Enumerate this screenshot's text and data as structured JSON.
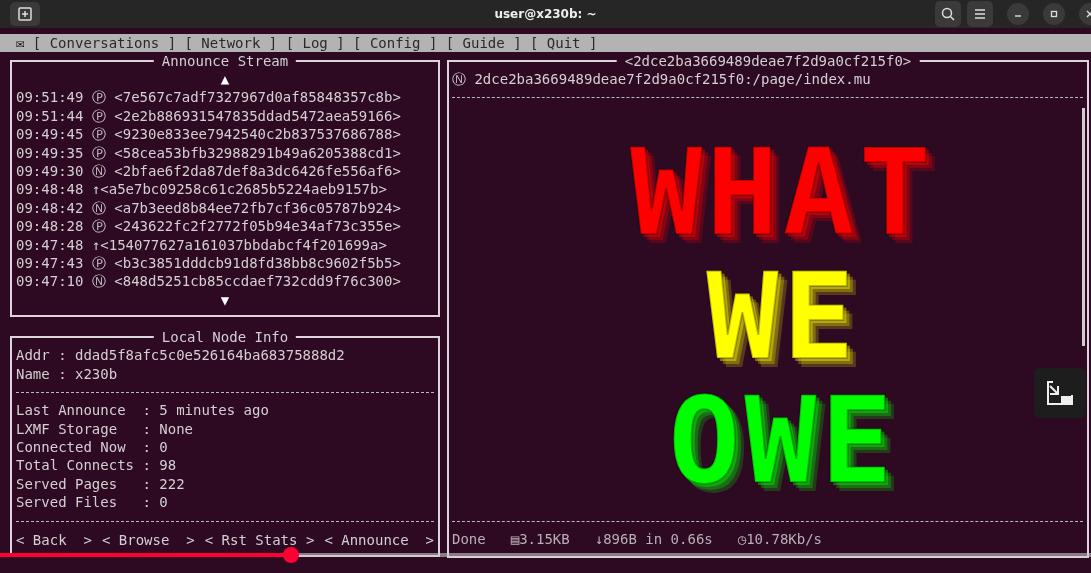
{
  "window": {
    "title": "user@x230b: ~"
  },
  "menu": {
    "icon": "✉",
    "items": [
      {
        "label": "[ Conversations ]"
      },
      {
        "label": "[ Network ]"
      },
      {
        "label": "[ Log ]"
      },
      {
        "label": "[ Config ]"
      },
      {
        "label": "[ Guide ]"
      },
      {
        "label": "[ Quit ]"
      }
    ]
  },
  "announce_stream": {
    "title": "Announce Stream",
    "up_arrow": "▲",
    "down_arrow": "▼",
    "entries": [
      {
        "time": "09:51:49",
        "symbol": "Ⓟ",
        "address": "<7e567c7adf7327967d0af85848357c8b>"
      },
      {
        "time": "09:51:44",
        "symbol": "Ⓟ",
        "address": "<2e2b886931547835ddad5472aea59166>"
      },
      {
        "time": "09:49:45",
        "symbol": "Ⓟ",
        "address": "<9230e833ee7942540c2b837537686788>"
      },
      {
        "time": "09:49:35",
        "symbol": "Ⓟ",
        "address": "<58cea53bfb32988291b49a6205388cd1>"
      },
      {
        "time": "09:49:30",
        "symbol": "Ⓝ",
        "address": "<2bfae6f2da87def8a3dc6426fe556af6>"
      },
      {
        "time": "09:48:48",
        "symbol": "↑",
        "address": "<a5e7bc09258c61c2685b5224aeb9157b>"
      },
      {
        "time": "09:48:42",
        "symbol": "Ⓝ",
        "address": "<a7b3eed8b84ee72fb7cf36c05787b924>"
      },
      {
        "time": "09:48:28",
        "symbol": "Ⓟ",
        "address": "<243622fc2f2772f05b94e34af73c355e>"
      },
      {
        "time": "09:47:48",
        "symbol": "↑",
        "address": "<154077627a161037bbdabcf4f201699a>"
      },
      {
        "time": "09:47:43",
        "symbol": "Ⓟ",
        "address": "<b3c3851dddcb91d8fd38bb8c9602f5b5>"
      },
      {
        "time": "09:47:10",
        "symbol": "Ⓝ",
        "address": "<848d5251cb85ccdaef732cdd9f76c300>"
      }
    ]
  },
  "local_node_info": {
    "title": "Local Node Info",
    "identity": [
      "Addr : ddad5f8afc5c0e526164ba68375888d2",
      "Name : x230b"
    ],
    "stats": [
      "Last Announce  : 5 minutes ago",
      "LXMF Storage   : None",
      "Connected Now  : 0",
      "Total Connects : 98",
      "Served Pages   : 222",
      "Served Files   : 0"
    ],
    "buttons": [
      "< Back  >",
      "< Browse  >",
      "< Rst Stats >",
      "< Announce  >"
    ]
  },
  "browser": {
    "title": "<2dce2ba3669489deae7f2d9a0cf215f0>",
    "url_symbol": "Ⓝ",
    "url": "2dce2ba3669489deae7f2d9a0cf215f0:/page/index.mu",
    "page_lines": [
      {
        "text": "WHAT",
        "color": "#ff0000"
      },
      {
        "text": "WE",
        "color": "#ffff00"
      },
      {
        "text": "OWE",
        "color": "#00ff00"
      }
    ],
    "status": {
      "state": "Done",
      "size": "▤3.15KB",
      "transfer": "↓896B in 0.66s",
      "speed": "◷10.78Kb/s"
    }
  },
  "video_player": {
    "progress": {
      "level": 0.267
    }
  }
}
